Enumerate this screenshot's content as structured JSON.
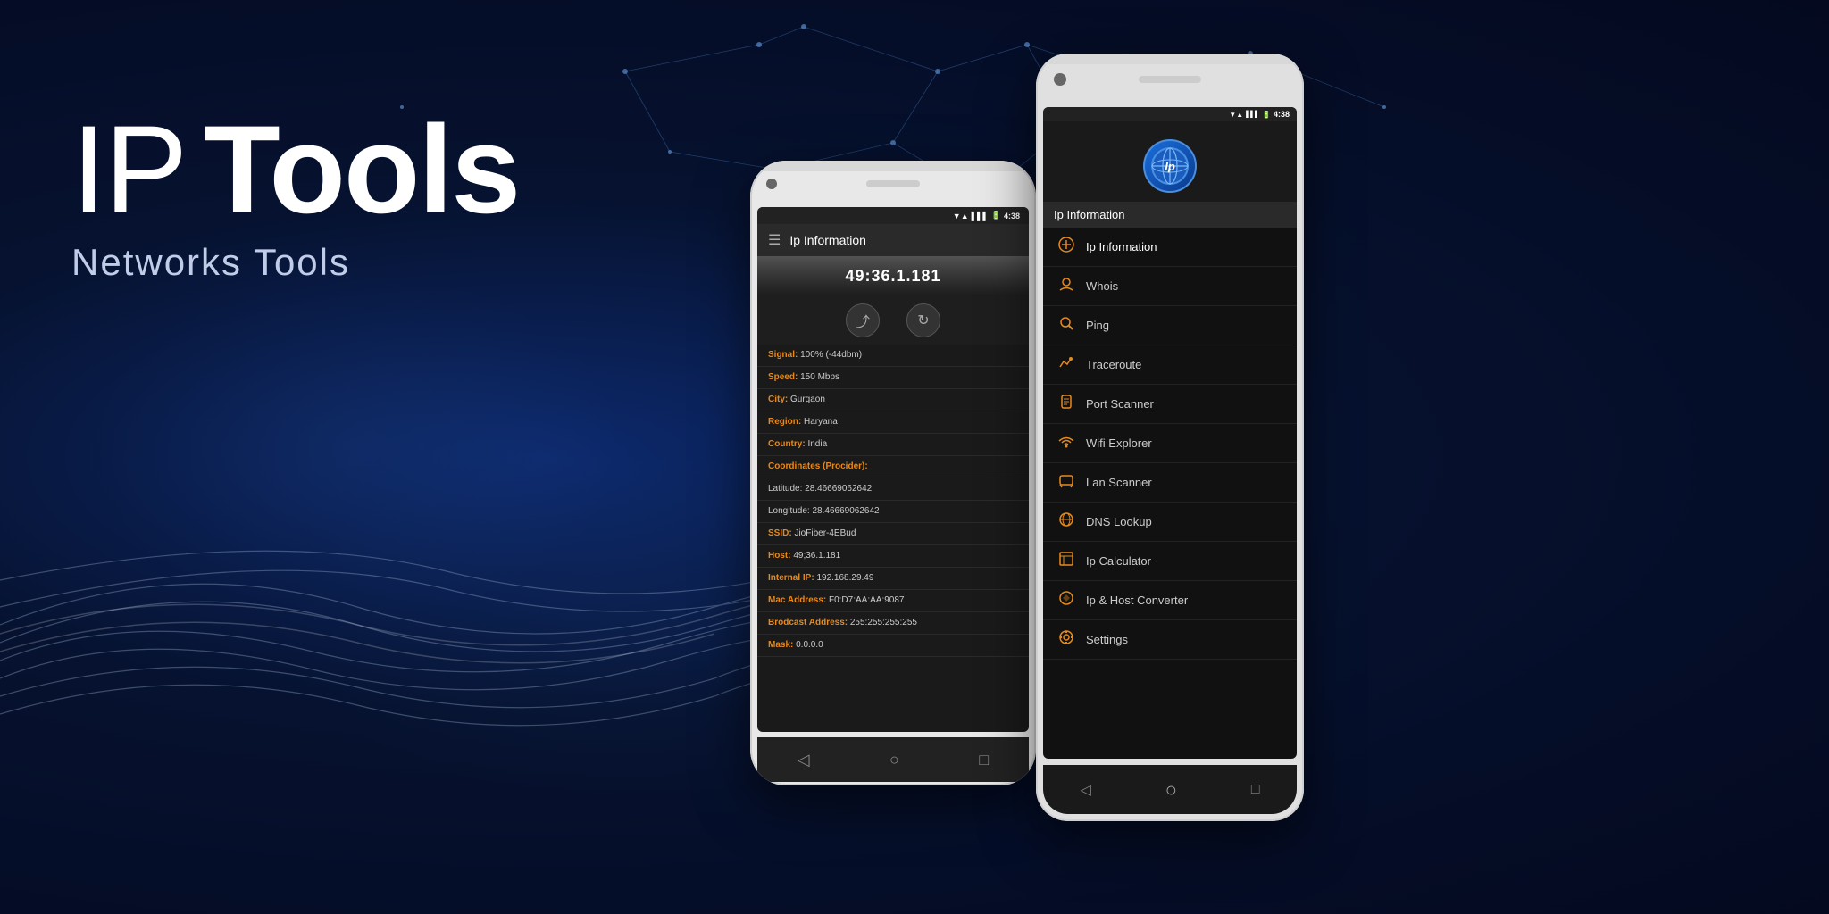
{
  "app": {
    "title": "IP Tools",
    "subtitle": "Networks Tools",
    "title_ip": "IP",
    "title_tools": "Tools"
  },
  "phone1": {
    "status_bar": {
      "signal": "▼▲",
      "wifi": "WiFi",
      "battery": "🔋",
      "time": "4:38"
    },
    "app_bar_title": "Ip Information",
    "ip_address": "49:36.1.181",
    "info_rows": [
      {
        "label": "Signal:",
        "value": "100% (-44dbm)"
      },
      {
        "label": "Speed:",
        "value": "150 Mbps"
      },
      {
        "label": "City:",
        "value": "Gurgaon"
      },
      {
        "label": "Region:",
        "value": "Haryana"
      },
      {
        "label": "Country:",
        "value": "India"
      },
      {
        "label": "Coordinates (Procider):",
        "value": ""
      },
      {
        "label": "",
        "value": "Latitude: 28.46669062642"
      },
      {
        "label": "",
        "value": "Longitude: 28.46669062642"
      },
      {
        "label": "SSID:",
        "value": "JioFiber-4EBud"
      },
      {
        "label": "Host:",
        "value": "49;36.1.181"
      },
      {
        "label": "Internal IP:",
        "value": "192.168.29.49"
      },
      {
        "label": "Mac Address:",
        "value": "F0:D7:AA:AA:9087"
      },
      {
        "label": "Brodcast Address:",
        "value": "255:255:255:255"
      },
      {
        "label": "Mask:",
        "value": "0.0.0.0"
      }
    ]
  },
  "phone2": {
    "status_bar": {
      "time": "4:38"
    },
    "app_title": "Ip",
    "menu_title": "Ip Information",
    "menu_items": [
      {
        "icon": "📡",
        "label": "Ip Information",
        "active": true
      },
      {
        "icon": "👤",
        "label": "Whois",
        "active": false
      },
      {
        "icon": "🔍",
        "label": "Ping",
        "active": false
      },
      {
        "icon": "🗺",
        "label": "Traceroute",
        "active": false
      },
      {
        "icon": "🔌",
        "label": "Port Scanner",
        "active": false
      },
      {
        "icon": "📶",
        "label": "Wifi Explorer",
        "active": false
      },
      {
        "icon": "🖥",
        "label": "Lan Scanner",
        "active": false
      },
      {
        "icon": "🌐",
        "label": "DNS Lookup",
        "active": false
      },
      {
        "icon": "🧮",
        "label": "Ip Calculator",
        "active": false
      },
      {
        "icon": "⚙",
        "label": "Ip & Host Converter",
        "active": false
      },
      {
        "icon": "⚙",
        "label": "Settings",
        "active": false
      }
    ]
  },
  "colors": {
    "accent": "#e8891a",
    "bg_dark": "#111111",
    "bg_medium": "#1a1a1a",
    "text_light": "#cccccc",
    "bg_gradient_start": "#0d2a6e",
    "bg_gradient_end": "#04091f"
  }
}
